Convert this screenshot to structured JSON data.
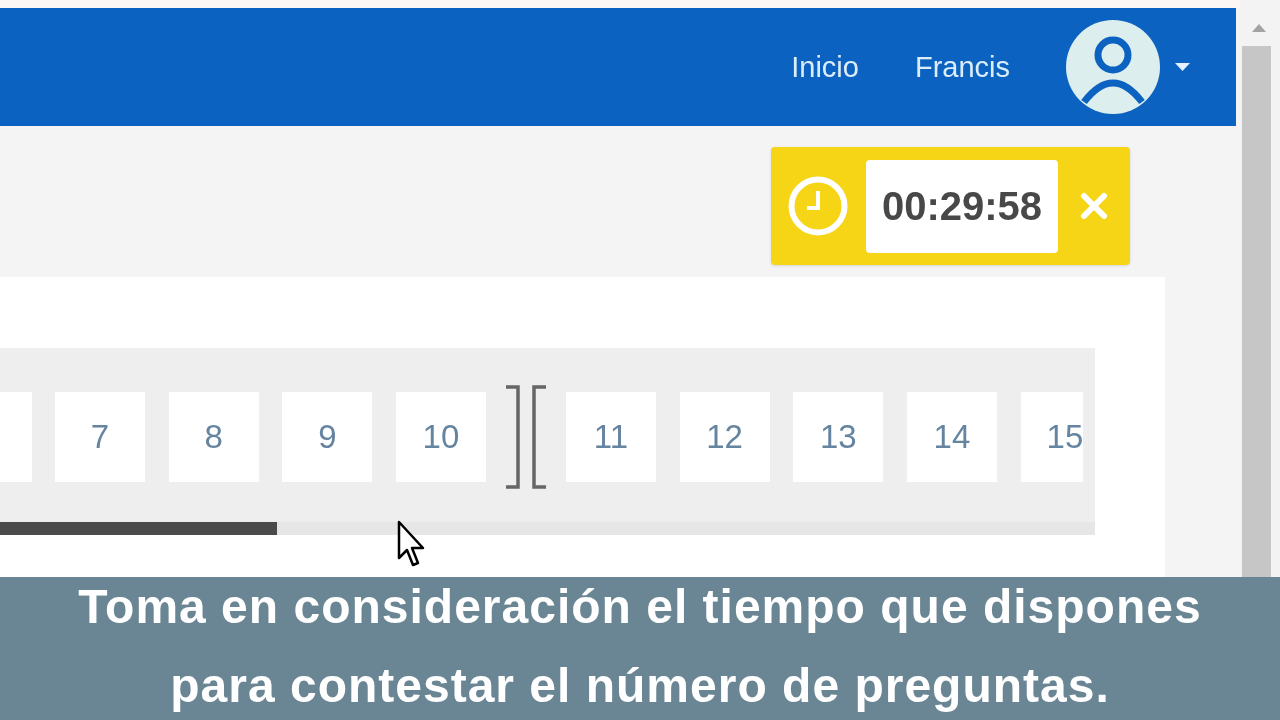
{
  "nav": {
    "links": [
      {
        "label": "Inicio"
      },
      {
        "label": "Francis"
      }
    ]
  },
  "timer": {
    "time": "00:29:58"
  },
  "question_groups": [
    {
      "questions": [
        {
          "label": "7"
        },
        {
          "label": "8"
        },
        {
          "label": "9"
        },
        {
          "label": "10"
        }
      ]
    },
    {
      "questions": [
        {
          "label": "11"
        },
        {
          "label": "12"
        },
        {
          "label": "13"
        },
        {
          "label": "14"
        },
        {
          "label": "15"
        }
      ]
    }
  ],
  "caption": {
    "lines": [
      "Toma en consideración el tiempo que dispones",
      "para contestar el número de preguntas."
    ]
  }
}
